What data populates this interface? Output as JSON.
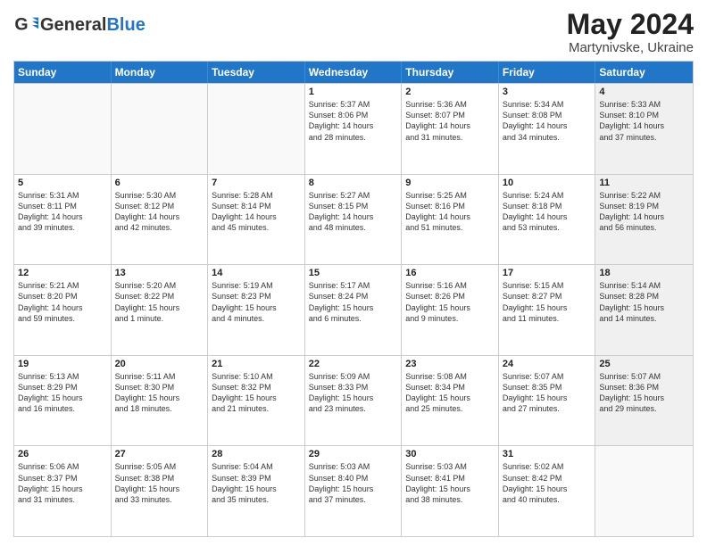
{
  "header": {
    "logo_general": "General",
    "logo_blue": "Blue",
    "title": "May 2024",
    "subtitle": "Martynivske, Ukraine"
  },
  "days_of_week": [
    "Sunday",
    "Monday",
    "Tuesday",
    "Wednesday",
    "Thursday",
    "Friday",
    "Saturday"
  ],
  "weeks": [
    [
      {
        "day": "",
        "info": "",
        "empty": true
      },
      {
        "day": "",
        "info": "",
        "empty": true
      },
      {
        "day": "",
        "info": "",
        "empty": true
      },
      {
        "day": "1",
        "info": "Sunrise: 5:37 AM\nSunset: 8:06 PM\nDaylight: 14 hours\nand 28 minutes."
      },
      {
        "day": "2",
        "info": "Sunrise: 5:36 AM\nSunset: 8:07 PM\nDaylight: 14 hours\nand 31 minutes."
      },
      {
        "day": "3",
        "info": "Sunrise: 5:34 AM\nSunset: 8:08 PM\nDaylight: 14 hours\nand 34 minutes."
      },
      {
        "day": "4",
        "info": "Sunrise: 5:33 AM\nSunset: 8:10 PM\nDaylight: 14 hours\nand 37 minutes.",
        "shaded": true
      }
    ],
    [
      {
        "day": "5",
        "info": "Sunrise: 5:31 AM\nSunset: 8:11 PM\nDaylight: 14 hours\nand 39 minutes."
      },
      {
        "day": "6",
        "info": "Sunrise: 5:30 AM\nSunset: 8:12 PM\nDaylight: 14 hours\nand 42 minutes."
      },
      {
        "day": "7",
        "info": "Sunrise: 5:28 AM\nSunset: 8:14 PM\nDaylight: 14 hours\nand 45 minutes."
      },
      {
        "day": "8",
        "info": "Sunrise: 5:27 AM\nSunset: 8:15 PM\nDaylight: 14 hours\nand 48 minutes."
      },
      {
        "day": "9",
        "info": "Sunrise: 5:25 AM\nSunset: 8:16 PM\nDaylight: 14 hours\nand 51 minutes."
      },
      {
        "day": "10",
        "info": "Sunrise: 5:24 AM\nSunset: 8:18 PM\nDaylight: 14 hours\nand 53 minutes."
      },
      {
        "day": "11",
        "info": "Sunrise: 5:22 AM\nSunset: 8:19 PM\nDaylight: 14 hours\nand 56 minutes.",
        "shaded": true
      }
    ],
    [
      {
        "day": "12",
        "info": "Sunrise: 5:21 AM\nSunset: 8:20 PM\nDaylight: 14 hours\nand 59 minutes."
      },
      {
        "day": "13",
        "info": "Sunrise: 5:20 AM\nSunset: 8:22 PM\nDaylight: 15 hours\nand 1 minute."
      },
      {
        "day": "14",
        "info": "Sunrise: 5:19 AM\nSunset: 8:23 PM\nDaylight: 15 hours\nand 4 minutes."
      },
      {
        "day": "15",
        "info": "Sunrise: 5:17 AM\nSunset: 8:24 PM\nDaylight: 15 hours\nand 6 minutes."
      },
      {
        "day": "16",
        "info": "Sunrise: 5:16 AM\nSunset: 8:26 PM\nDaylight: 15 hours\nand 9 minutes."
      },
      {
        "day": "17",
        "info": "Sunrise: 5:15 AM\nSunset: 8:27 PM\nDaylight: 15 hours\nand 11 minutes."
      },
      {
        "day": "18",
        "info": "Sunrise: 5:14 AM\nSunset: 8:28 PM\nDaylight: 15 hours\nand 14 minutes.",
        "shaded": true
      }
    ],
    [
      {
        "day": "19",
        "info": "Sunrise: 5:13 AM\nSunset: 8:29 PM\nDaylight: 15 hours\nand 16 minutes."
      },
      {
        "day": "20",
        "info": "Sunrise: 5:11 AM\nSunset: 8:30 PM\nDaylight: 15 hours\nand 18 minutes."
      },
      {
        "day": "21",
        "info": "Sunrise: 5:10 AM\nSunset: 8:32 PM\nDaylight: 15 hours\nand 21 minutes."
      },
      {
        "day": "22",
        "info": "Sunrise: 5:09 AM\nSunset: 8:33 PM\nDaylight: 15 hours\nand 23 minutes."
      },
      {
        "day": "23",
        "info": "Sunrise: 5:08 AM\nSunset: 8:34 PM\nDaylight: 15 hours\nand 25 minutes."
      },
      {
        "day": "24",
        "info": "Sunrise: 5:07 AM\nSunset: 8:35 PM\nDaylight: 15 hours\nand 27 minutes."
      },
      {
        "day": "25",
        "info": "Sunrise: 5:07 AM\nSunset: 8:36 PM\nDaylight: 15 hours\nand 29 minutes.",
        "shaded": true
      }
    ],
    [
      {
        "day": "26",
        "info": "Sunrise: 5:06 AM\nSunset: 8:37 PM\nDaylight: 15 hours\nand 31 minutes."
      },
      {
        "day": "27",
        "info": "Sunrise: 5:05 AM\nSunset: 8:38 PM\nDaylight: 15 hours\nand 33 minutes."
      },
      {
        "day": "28",
        "info": "Sunrise: 5:04 AM\nSunset: 8:39 PM\nDaylight: 15 hours\nand 35 minutes."
      },
      {
        "day": "29",
        "info": "Sunrise: 5:03 AM\nSunset: 8:40 PM\nDaylight: 15 hours\nand 37 minutes."
      },
      {
        "day": "30",
        "info": "Sunrise: 5:03 AM\nSunset: 8:41 PM\nDaylight: 15 hours\nand 38 minutes."
      },
      {
        "day": "31",
        "info": "Sunrise: 5:02 AM\nSunset: 8:42 PM\nDaylight: 15 hours\nand 40 minutes."
      },
      {
        "day": "",
        "info": "",
        "empty": true,
        "shaded": true
      }
    ]
  ]
}
